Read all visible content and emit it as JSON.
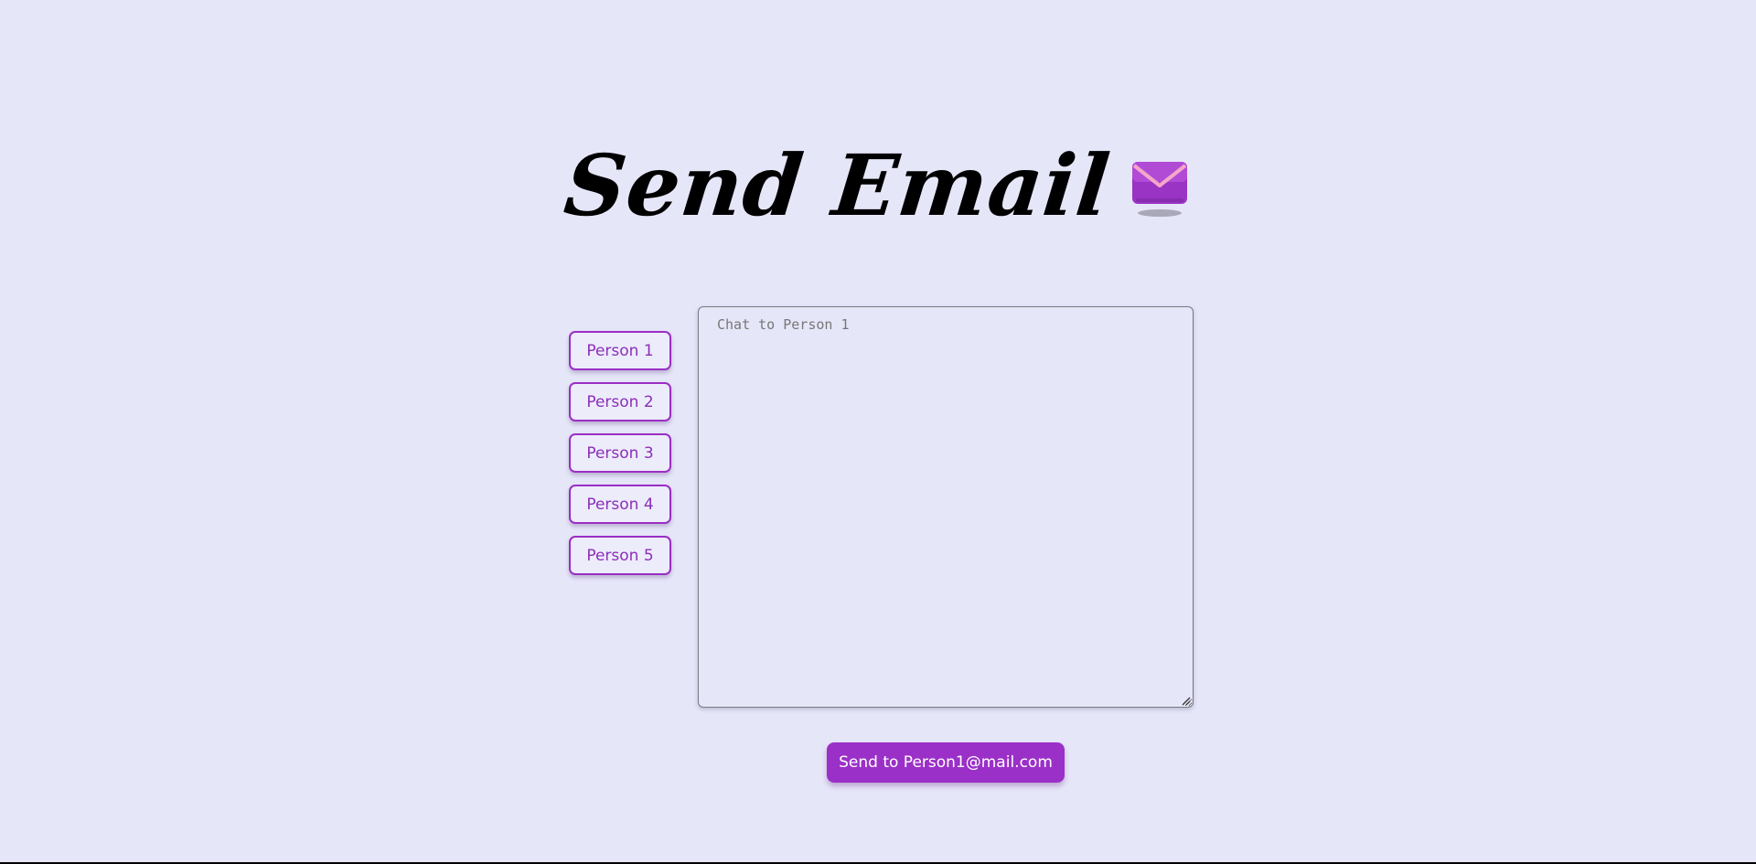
{
  "header": {
    "title": "Send Email",
    "title_icon": "envelope-icon"
  },
  "recipients": [
    {
      "label": "Person 1"
    },
    {
      "label": "Person 2"
    },
    {
      "label": "Person 3"
    },
    {
      "label": "Person 4"
    },
    {
      "label": "Person 5"
    }
  ],
  "message": {
    "value": "",
    "placeholder": "Chat to Person 1"
  },
  "send": {
    "label": "Send to Person1@mail.com"
  },
  "colors": {
    "background": "#e6e6f9",
    "accent": "#9b30c8",
    "button_text": "#8c2fb8",
    "title": "#000000"
  }
}
